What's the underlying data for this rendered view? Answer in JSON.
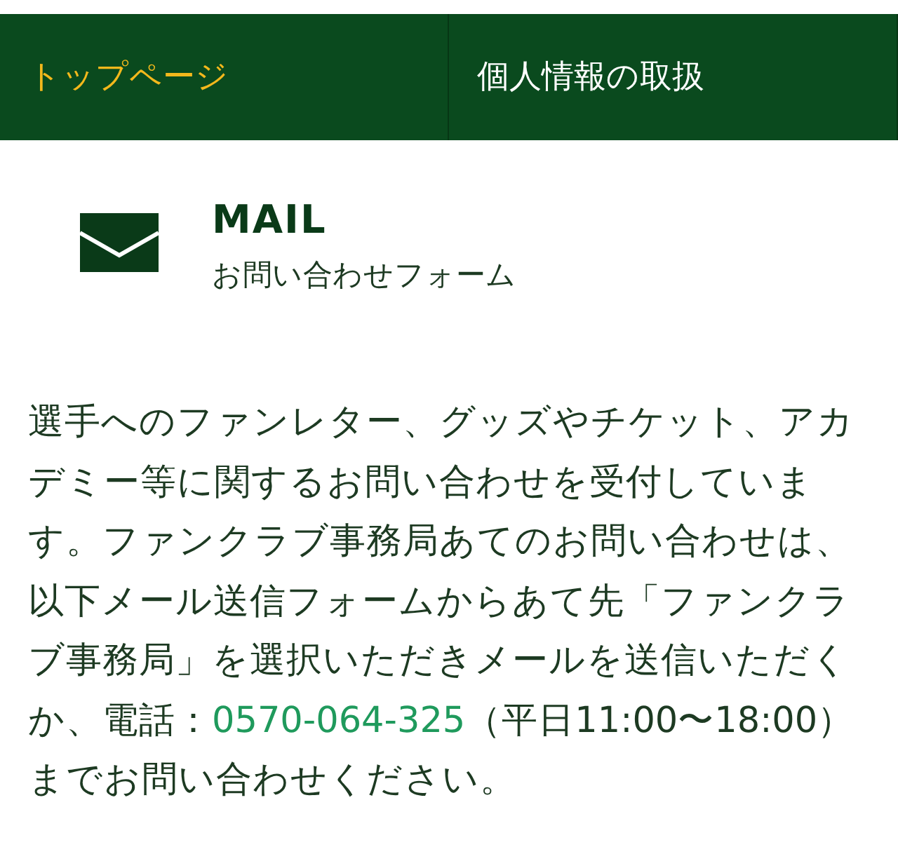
{
  "nav": [
    {
      "label": "トップページ",
      "selected": true
    },
    {
      "label": "個人情報の取扱",
      "selected": false
    }
  ],
  "heading": {
    "title": "MAIL",
    "subtitle": "お問い合わせフォーム"
  },
  "intro": {
    "before": "選手へのファンレター、グッズやチケット、アカデミー等に関するお問い合わせを受付しています。ファンクラブ事務局あてのお問い合わせは、以下メール送信フォームからあて先「ファンクラブ事務局」を選択いただきメールを送信いただくか、電話：",
    "phone": "0570-064-325",
    "after": "（平日11:00〜18:00）までお問い合わせください。"
  }
}
